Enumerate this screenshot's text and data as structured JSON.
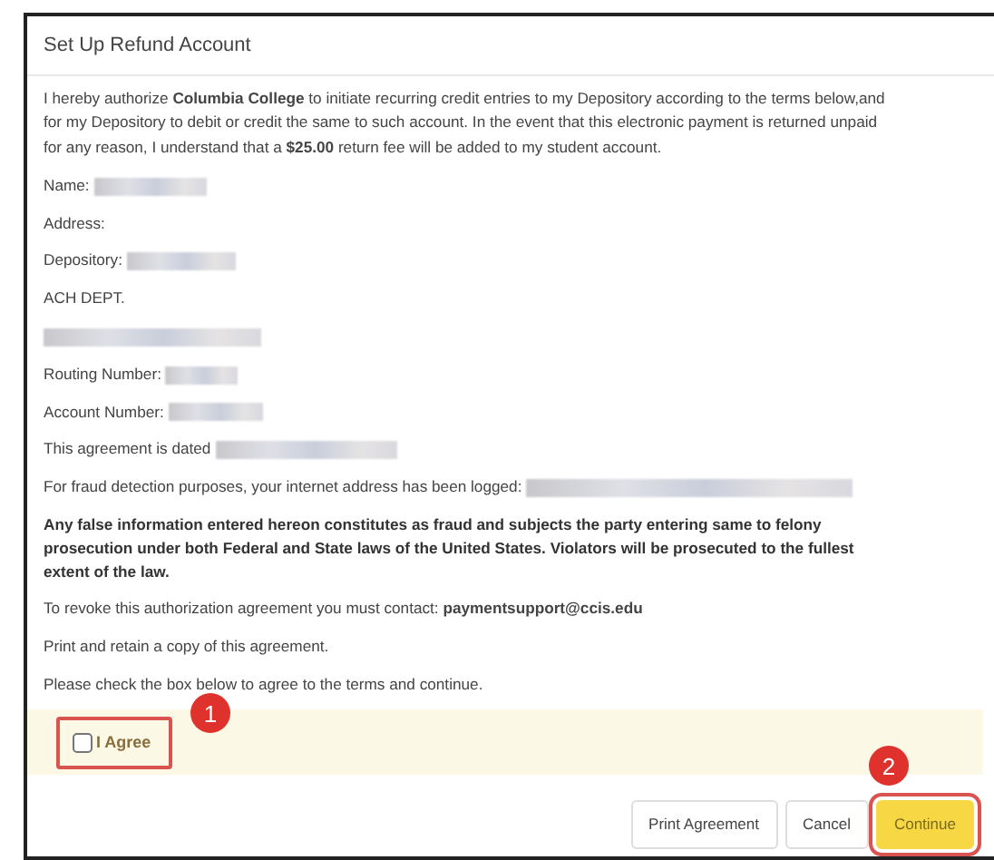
{
  "dialog": {
    "title": "Set Up Refund Account"
  },
  "lines": [
    {
      "kind": "paragraph",
      "text": "I hereby authorize **Columbia College** to initiate recurring credit entries to my Depository according to the terms below,and for my Depository to debit or credit the same to such account. In the event that this electronic payment is returned unpaid for any reason, I understand that a **$25.00** return fee will be added to my student account."
    },
    {
      "kind": "redacted_field",
      "label": "Name:"
    },
    {
      "kind": "paragraph",
      "text": "Address:"
    },
    {
      "kind": "redacted_field",
      "label": "Depository:"
    },
    {
      "kind": "paragraph",
      "text": "ACH DEPT."
    },
    {
      "kind": "redacted"
    },
    {
      "kind": "redacted_field",
      "label": "Routing Number:"
    },
    {
      "kind": "redacted_field",
      "label": "Account Number:"
    },
    {
      "kind": "redacted_field",
      "label": "This agreement is dated"
    },
    {
      "kind": "redacted_field",
      "label": "For fraud detection purposes, your internet address has been logged:"
    },
    {
      "kind": "warning",
      "text": "Any false information entered hereon constitutes as fraud and subjects the party entering same to felony prosecution under both Federal and State laws of the United States. Violators will be prosecuted to the fullest extent of the law."
    },
    {
      "kind": "paragraph",
      "text": "To revoke this authorization agreement you must contact: **paymentsupport@ccis.edu**"
    },
    {
      "kind": "paragraph",
      "text": "Print and retain a copy of this agreement."
    },
    {
      "kind": "paragraph",
      "text": "Please check the box below to agree to the terms and continue."
    }
  ],
  "agree": {
    "label": "I Agree",
    "checked": false,
    "callout": "1"
  },
  "buttons": [
    {
      "label": "Print Agreement",
      "kind": "secondary"
    },
    {
      "label": "Cancel",
      "kind": "secondary"
    },
    {
      "label": "Continue",
      "kind": "primary",
      "callout": "2"
    }
  ]
}
